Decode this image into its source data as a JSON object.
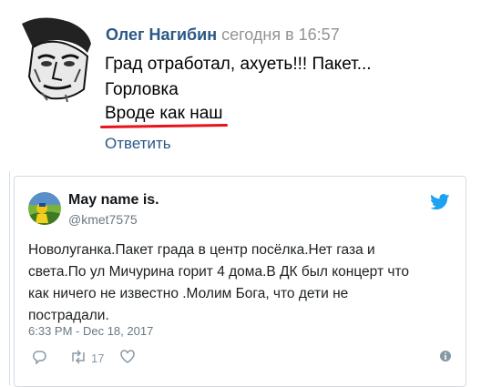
{
  "post": {
    "author": "Олег Нагибин",
    "time": "сегодня в 16:57",
    "lines": [
      "Град отработал, ахуеть!!! Пакет...",
      "Горловка",
      "Вроде как наш"
    ],
    "reply_label": "Ответить"
  },
  "tweet": {
    "name": "May name is.",
    "handle": "@kmet7575",
    "lines": [
      "Новолуганка.Пакет града в центр посёлка.Нет газа и",
      "света.По ул Мичурина горит 4 дома.В ДК был концерт что",
      "как ничего не известно .Молим Бога, что дети не",
      "пострадали."
    ],
    "timestamp": "6:33 PM - Dec 18, 2017",
    "retweet_count": "17",
    "icons": [
      "reply-icon",
      "retweet-icon",
      "like-icon",
      "info-icon",
      "twitter-bird-icon"
    ]
  },
  "colors": {
    "link": "#2a5885",
    "underline": "#e8121a",
    "twitter": "#1da1f2"
  }
}
